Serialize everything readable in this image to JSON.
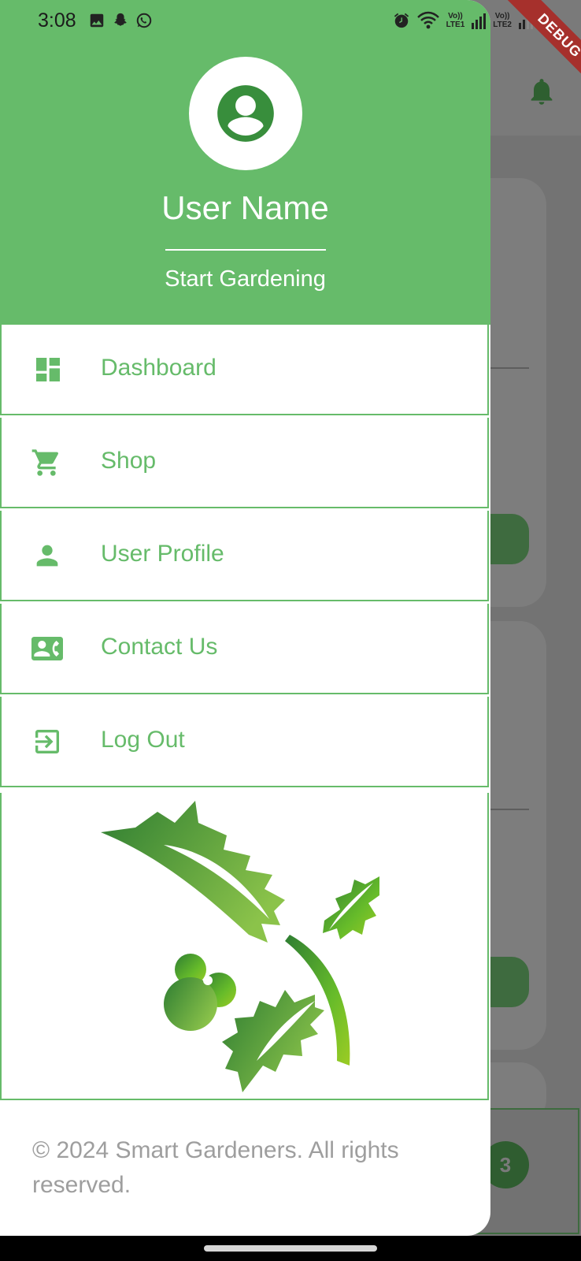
{
  "status_bar": {
    "time": "3:08",
    "left_icons": [
      "image-icon",
      "snapchat-icon",
      "whatsapp-icon"
    ],
    "right_icons": [
      "alarm-icon",
      "wifi-icon",
      "signal-sim1-icon",
      "signal-sim2-icon"
    ],
    "sim1_label_top": "Vo))",
    "sim1_label_bottom": "LTE1",
    "sim2_label_top": "Vo))",
    "sim2_label_bottom": "LTE2"
  },
  "debug_banner": "DEBUG",
  "drawer": {
    "user_name": "User Name",
    "subtitle": "Start Gardening",
    "avatar_icon": "account-circle-icon",
    "menu": [
      {
        "label": "Dashboard",
        "icon": "dashboard-icon"
      },
      {
        "label": "Shop",
        "icon": "shopping-cart-icon"
      },
      {
        "label": "User Profile",
        "icon": "person-icon"
      },
      {
        "label": "Contact Us",
        "icon": "contact-phone-icon"
      },
      {
        "label": "Log Out",
        "icon": "logout-icon"
      }
    ],
    "footer": "© 2024 Smart Gardeners. All rights reserved."
  },
  "background_app": {
    "badge_value": "3",
    "bell_icon": "notification-bell-icon"
  },
  "colors": {
    "primary": "#66bb6a",
    "primary_dark": "#388e3c",
    "footer_text": "#9e9e9e",
    "debug": "#a6302c"
  }
}
